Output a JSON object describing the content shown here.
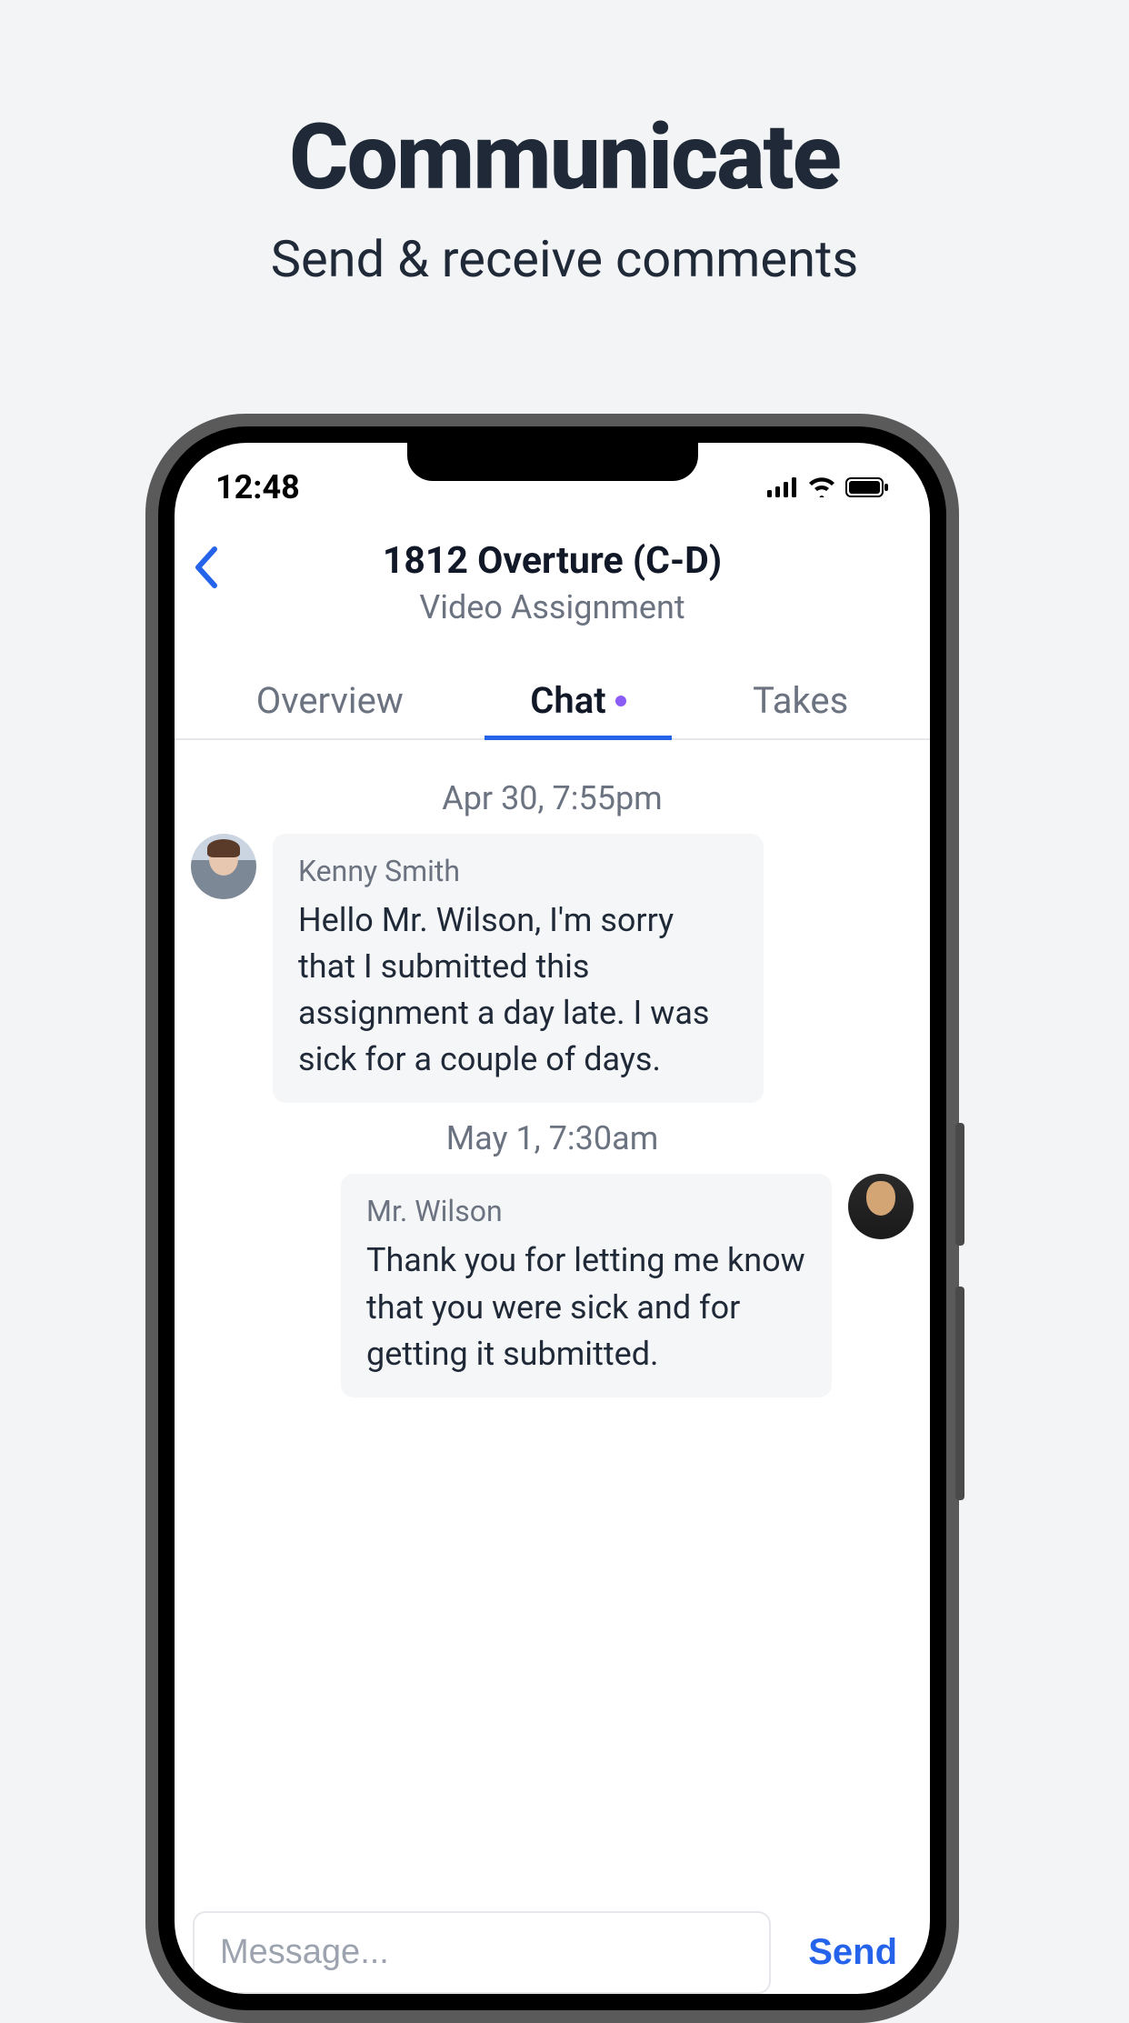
{
  "promo": {
    "title": "Communicate",
    "subtitle": "Send & receive comments"
  },
  "status": {
    "time": "12:48"
  },
  "nav": {
    "title": "1812 Overture (C-D)",
    "subtitle": "Video Assignment"
  },
  "tabs": {
    "overview": "Overview",
    "chat": "Chat",
    "takes": "Takes",
    "active": "chat",
    "has_notification": true
  },
  "chat": {
    "groups": [
      {
        "timestamp": "Apr 30, 7:55pm",
        "messages": [
          {
            "side": "left",
            "sender": "Kenny Smith",
            "text": "Hello Mr. Wilson, I'm sorry that I submitted this assignment a day late. I was sick for a couple of days."
          }
        ]
      },
      {
        "timestamp": "May 1, 7:30am",
        "messages": [
          {
            "side": "right",
            "sender": "Mr. Wilson",
            "text": "Thank you for letting me know that you were sick and for getting it submitted."
          }
        ]
      }
    ]
  },
  "input": {
    "placeholder": "Message...",
    "send_label": "Send"
  }
}
